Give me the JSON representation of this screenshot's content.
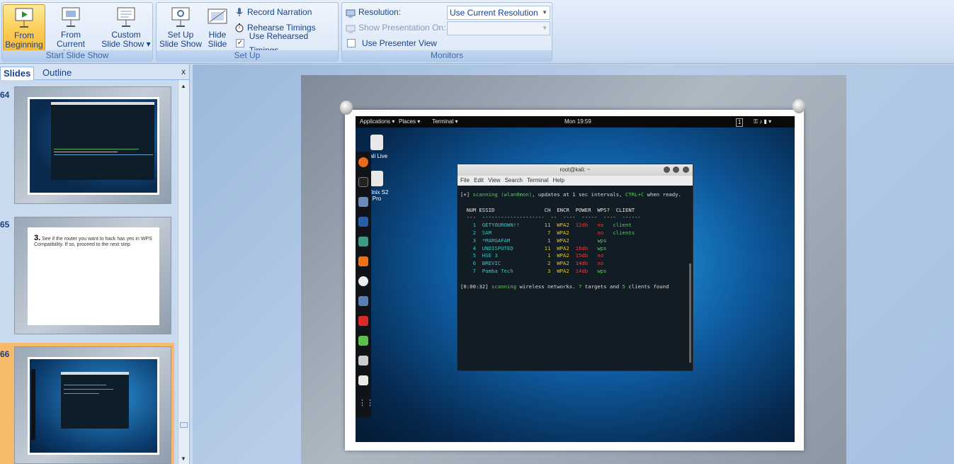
{
  "ribbon": {
    "start_group": {
      "label": "Start Slide Show",
      "from_beginning": [
        "From",
        "Beginning"
      ],
      "from_current": [
        "From",
        "Current Slide"
      ],
      "custom": [
        "Custom",
        "Slide Show ▾"
      ]
    },
    "setup_group": {
      "label": "Set Up",
      "setup_show": [
        "Set Up",
        "Slide Show"
      ],
      "hide_slide": [
        "Hide",
        "Slide"
      ],
      "record_narration": "Record Narration",
      "rehearse_timings": "Rehearse Timings",
      "use_rehearsed": "Use Rehearsed Timings",
      "use_rehearsed_checked": true
    },
    "monitors_group": {
      "label": "Monitors",
      "resolution_label": "Resolution:",
      "resolution_value": "Use Current Resolution",
      "show_on_label": "Show Presentation On:",
      "show_on_value": "",
      "presenter_view": "Use Presenter View",
      "presenter_view_checked": false
    }
  },
  "slides_panel": {
    "tab_slides": "Slides",
    "tab_outline": "Outline",
    "close": "x",
    "thumbnails": [
      {
        "number": "64"
      },
      {
        "number": "65",
        "step_num": "3.",
        "text": "See if the router you want to hack has yes in WPS Compatibility. If so, proceed to the next step."
      },
      {
        "number": "66"
      }
    ]
  },
  "slide": {
    "topbar": {
      "applications": "Applications ▾",
      "places": "Places ▾",
      "terminal": "Terminal ▾",
      "clock": "Mon 19:59",
      "workspace": "1"
    },
    "devices": [
      {
        "label": "Kali Live"
      },
      {
        "label": "Infinix S2 Pro"
      }
    ],
    "terminal": {
      "title": "root@kali: ~",
      "menu": [
        "File",
        "Edit",
        "View",
        "Search",
        "Terminal",
        "Help"
      ],
      "scan_line_prefix": "[+] ",
      "scan_word": "scanning",
      "scan_iface": "(wlan0mon)",
      "scan_rest": ", updates at 1 sec intervals, ",
      "scan_ctrl": "CTRL+C",
      "scan_end": " when ready.",
      "headers": [
        "NUM",
        "ESSID",
        "CH",
        "ENCR",
        "POWER",
        "WPS?",
        "CLIENT"
      ],
      "rows": [
        {
          "num": "1",
          "essid": "GETYOUROWN!!",
          "ch": "11",
          "encr": "WPA2",
          "power": "12db",
          "wps": "no",
          "client": "client"
        },
        {
          "num": "2",
          "essid": "SAM",
          "ch": "7",
          "encr": "WPA2",
          "power": "",
          "wps": "no",
          "client": "clients"
        },
        {
          "num": "3",
          "essid": "*MARGAFAM",
          "ch": "1",
          "encr": "WPA2",
          "power": "",
          "wps": "wps",
          "client": ""
        },
        {
          "num": "4",
          "essid": "UNDISPUTED",
          "ch": "11",
          "encr": "WPA2",
          "power": "18db",
          "wps": "wps",
          "client": ""
        },
        {
          "num": "5",
          "essid": "HSE 3",
          "ch": "1",
          "encr": "WPA2",
          "power": "15db",
          "wps": "no",
          "client": ""
        },
        {
          "num": "6",
          "essid": "BREVIC",
          "ch": "2",
          "encr": "WPA2",
          "power": "14db",
          "wps": "no",
          "client": ""
        },
        {
          "num": "7",
          "essid": "Pamba Tech",
          "ch": "3",
          "encr": "WPA2",
          "power": "14db",
          "wps": "wps",
          "client": ""
        }
      ],
      "status_time": "[0:00:32]",
      "status_scanning": "scanning",
      "status_mid": " wireless networks. ",
      "status_targets": "7",
      "status_mid2": " targets and ",
      "status_clients": "5",
      "status_end": " clients found"
    }
  },
  "colors": {
    "accent": "#15428b",
    "selected_thumb": "#f5a64b",
    "ribbon_active": "#fbd05c"
  }
}
